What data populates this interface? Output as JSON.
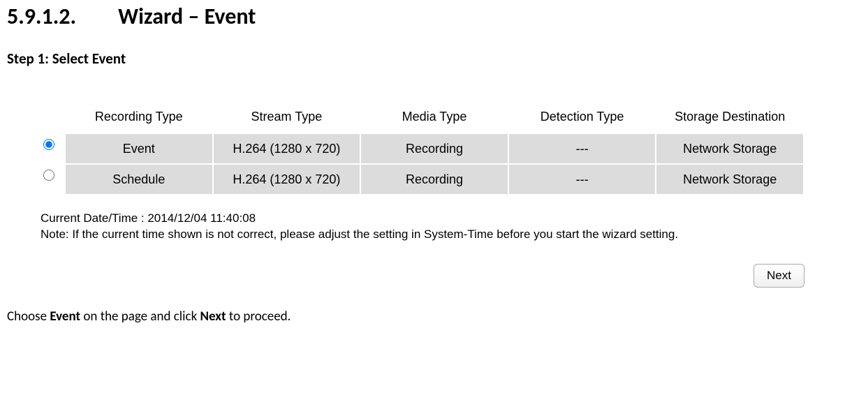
{
  "heading": {
    "number": "5.9.1.2.",
    "title": "Wizard – Event"
  },
  "step_title": "Step 1: Select Event",
  "table": {
    "headers": [
      "Recording Type",
      "Stream Type",
      "Media Type",
      "Detection Type",
      "Storage Destination"
    ],
    "rows": [
      {
        "selected": true,
        "cells": [
          "Event",
          "H.264 (1280 x 720)",
          "Recording",
          "---",
          "Network Storage"
        ]
      },
      {
        "selected": false,
        "cells": [
          "Schedule",
          "H.264 (1280 x 720)",
          "Recording",
          "---",
          "Network Storage"
        ]
      }
    ]
  },
  "info": {
    "datetime_label": "Current Date/Time : 2014/12/04 11:40:08",
    "note": "Note: If the current time shown is not correct, please adjust the setting in System-Time before you start the wizard setting."
  },
  "buttons": {
    "next": "Next"
  },
  "instruction": {
    "pre": "Choose ",
    "bold1": "Event",
    "mid": " on the page and click ",
    "bold2": "Next",
    "post": " to proceed."
  }
}
